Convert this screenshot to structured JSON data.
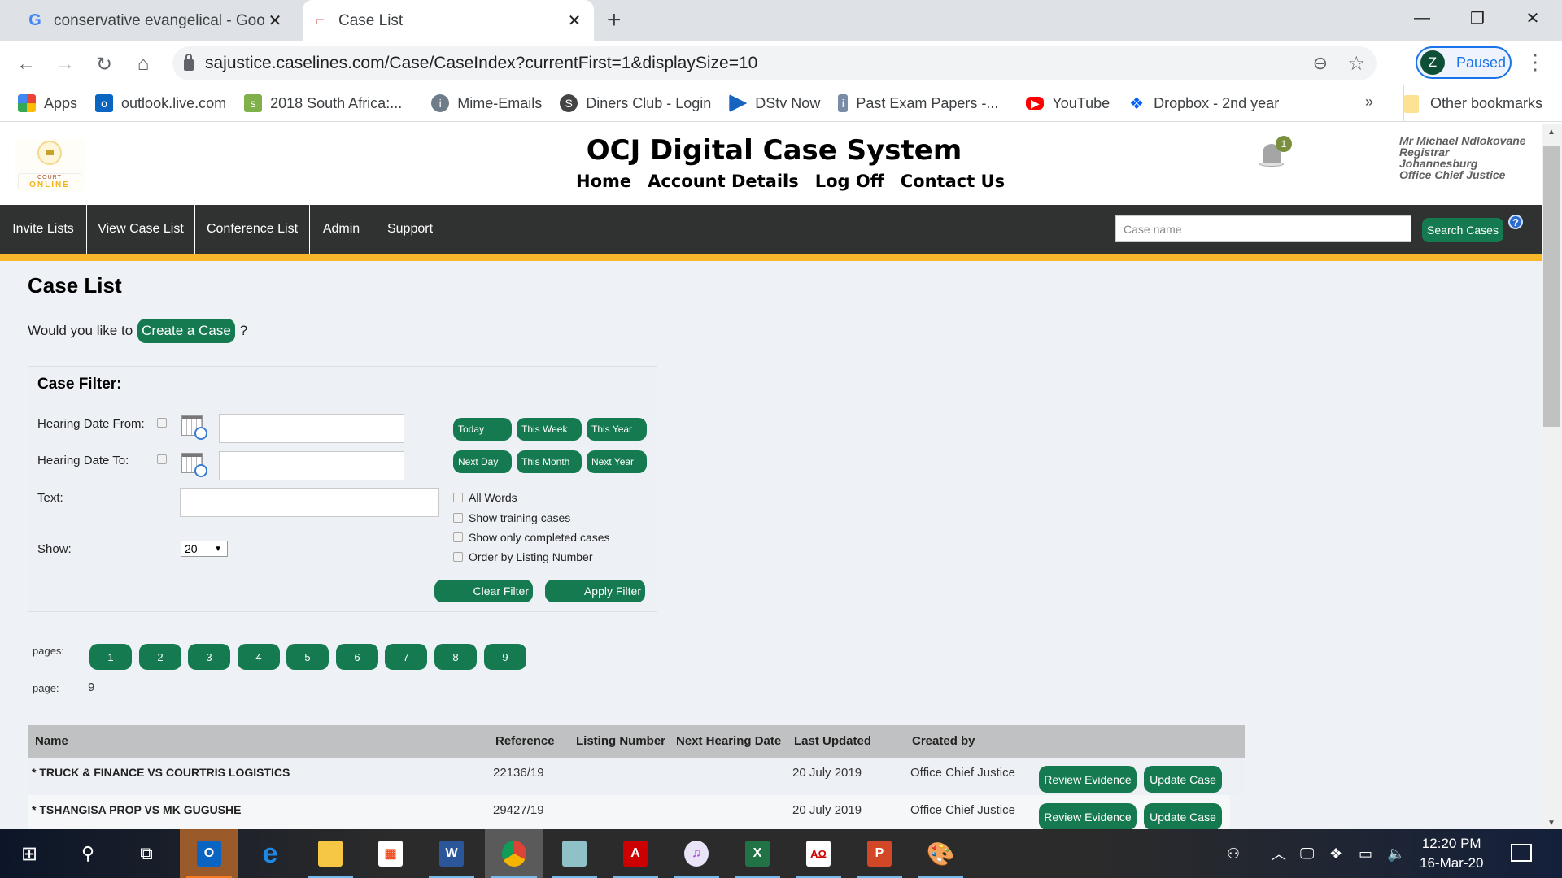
{
  "browser": {
    "tabs": [
      {
        "title": "conservative evangelical - Google Search",
        "icon": "google-icon",
        "active": false
      },
      {
        "title": "Case List",
        "icon": "caselines-icon",
        "active": true
      }
    ],
    "new_tab_label": "+",
    "url": "sajustice.caselines.com/Case/CaseIndex?currentFirst=1&displaySize=10",
    "profile": {
      "initial": "Z",
      "status": "Paused"
    },
    "bookmarks": [
      {
        "label": "Apps",
        "icon": "apps-grid-icon"
      },
      {
        "label": "outlook.live.com",
        "icon": "outlook-icon"
      },
      {
        "label": "2018 South Africa:...",
        "icon": "saflii-icon"
      },
      {
        "label": "Mime-Emails",
        "icon": "mime-icon"
      },
      {
        "label": "Diners Club - Login",
        "icon": "diners-icon"
      },
      {
        "label": "DStv Now",
        "icon": "dstv-icon"
      },
      {
        "label": "Past Exam Papers -...",
        "icon": "exam-icon"
      },
      {
        "label": "YouTube",
        "icon": "youtube-icon"
      },
      {
        "label": "Dropbox - 2nd year",
        "icon": "dropbox-icon"
      }
    ],
    "bookmarks_overflow": "»",
    "other_bookmarks": "Other bookmarks"
  },
  "site": {
    "title": "OCJ Digital Case System",
    "logo_text_top": "COURT",
    "logo_text_bottom": "ONLINE",
    "top_nav": [
      "Home",
      "Account Details",
      "Log Off",
      "Contact Us"
    ],
    "notifications_count": "1",
    "user": {
      "name": "Mr Michael Ndlokovane",
      "role": "Registrar",
      "location": "Johannesburg",
      "office": "Office Chief Justice"
    },
    "main_nav": [
      "Invite Lists",
      "View Case List",
      "Conference List",
      "Admin",
      "Support"
    ],
    "search": {
      "placeholder": "Case name",
      "value": "",
      "button": "Search Cases",
      "help": "?"
    }
  },
  "content": {
    "page_title": "Case List",
    "create_prompt": "Would you like to",
    "create_button": "Create a Case",
    "create_suffix": "?",
    "filter": {
      "title": "Case Filter:",
      "hearing_from_label": "Hearing Date From:",
      "hearing_to_label": "Hearing Date To:",
      "hearing_from_value": "",
      "hearing_to_value": "",
      "text_label": "Text:",
      "text_value": "",
      "show_label": "Show:",
      "show_value": "20",
      "quick_buttons": [
        "Today",
        "This Week",
        "This Year",
        "Next Day",
        "This Month",
        "Next Year"
      ],
      "options": [
        {
          "label": "All Words",
          "checked": false
        },
        {
          "label": "Show training cases",
          "checked": false
        },
        {
          "label": "Show only completed cases",
          "checked": false
        },
        {
          "label": "Order by Listing Number",
          "checked": false
        }
      ],
      "clear_button": "Clear Filter",
      "apply_button": "Apply Filter"
    },
    "pagination": {
      "pages_label": "pages:",
      "pages": [
        "1",
        "2",
        "3",
        "4",
        "5",
        "6",
        "7",
        "8",
        "9"
      ],
      "page_label": "page:",
      "current_page": "9"
    },
    "table": {
      "columns": [
        "Name",
        "Reference",
        "Listing Number",
        "Next Hearing Date",
        "Last Updated",
        "Created by"
      ],
      "rows": [
        {
          "name": "* TRUCK & FINANCE VS COURTRIS LOGISTICS",
          "reference": "22136/19",
          "listing_number": "",
          "next_hearing": "",
          "last_updated": "20 July 2019",
          "created_by": "Office Chief Justice",
          "review": "Review Evidence",
          "update": "Update Case"
        },
        {
          "name": "* TSHANGISA PROP VS MK GUGUSHE",
          "reference": "29427/19",
          "listing_number": "",
          "next_hearing": "",
          "last_updated": "20 July 2019",
          "created_by": "Office Chief Justice",
          "review": "Review Evidence",
          "update": "Update Case"
        }
      ]
    }
  },
  "taskbar": {
    "apps": [
      "start",
      "search",
      "task-view",
      "outlook",
      "edge",
      "file-explorer",
      "store",
      "word",
      "chrome",
      "notepad",
      "acrobat",
      "itunes",
      "excel",
      "unicode-app",
      "powerpoint",
      "paint"
    ],
    "time": "12:20 PM",
    "date": "16-Mar-20"
  },
  "colors": {
    "accent_green": "#167a50",
    "nav_dark": "#303231",
    "stripe_yellow": "#f8b72b",
    "page_bg": "#eef2f6"
  }
}
